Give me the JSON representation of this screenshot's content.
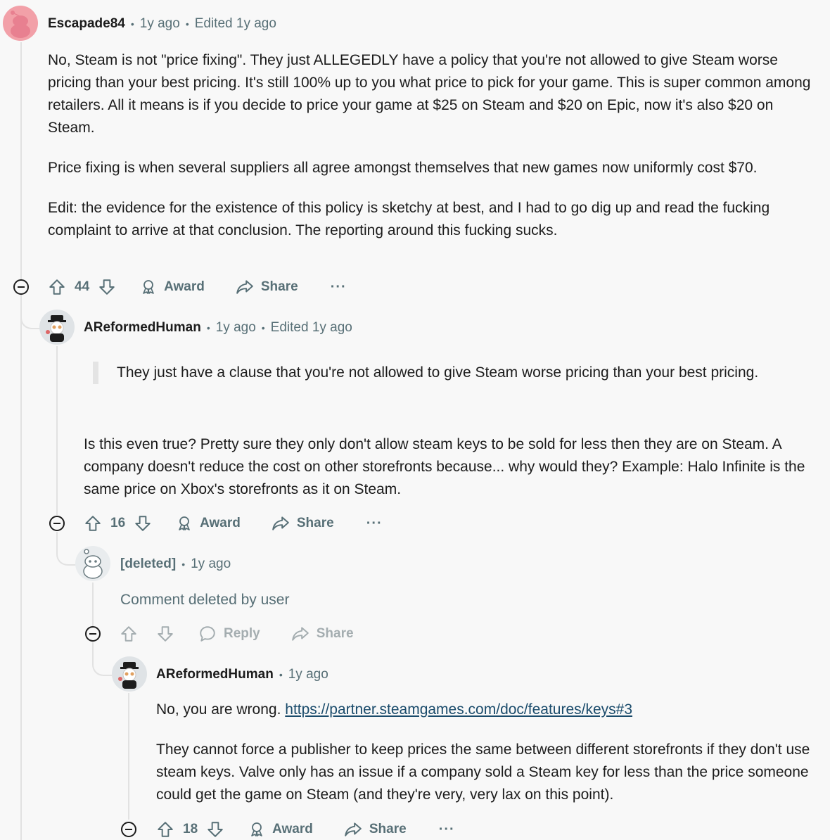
{
  "comments": [
    {
      "author": "Escapade84",
      "time": "1y ago",
      "edited": "Edited 1y ago",
      "paragraphs": [
        "No, Steam is not \"price fixing\". They just ALLEGEDLY have a policy that you're not allowed to give Steam worse pricing than your best pricing. It's still 100% up to you what price to pick for your game. This is super common among retailers. All it means is if you decide to price your game at $25 on Steam and $20 on Epic, now it's also $20 on Steam.",
        "Price fixing is when several suppliers all agree amongst themselves that new games now uniformly cost $70.",
        "Edit: the evidence for the existence of this policy is sketchy at best, and I had to go dig up and read the fucking complaint to arrive at that conclusion. The reporting around this fucking sucks."
      ],
      "score": "44",
      "award": "Award",
      "share": "Share",
      "more": "···"
    },
    {
      "author": "AReformedHuman",
      "time": "1y ago",
      "edited": "Edited 1y ago",
      "quote": "They just have a clause that you're not allowed to give Steam worse pricing than your best pricing.",
      "paragraphs": [
        "Is this even true? Pretty sure they only don't allow steam keys to be sold for less then they are on Steam. A company doesn't reduce the cost on other storefronts because... why would they? Example: Halo Infinite is the same price on Xbox's storefronts as it on Steam."
      ],
      "score": "16",
      "award": "Award",
      "share": "Share",
      "more": "···"
    },
    {
      "author": "[deleted]",
      "time": "1y ago",
      "body": "Comment deleted by user",
      "reply": "Reply",
      "share": "Share"
    },
    {
      "author": "AReformedHuman",
      "time": "1y ago",
      "lead": "No, you are wrong. ",
      "link": "https://partner.steamgames.com/doc/features/keys#3",
      "paragraph2": "They cannot force a publisher to keep prices the same between different storefronts if they don't use steam keys. Valve only has an issue if a company sold a Steam key for less than the price someone could get the game on Steam (and they're very, very lax on this point).",
      "score": "18",
      "award": "Award",
      "share": "Share",
      "more": "···"
    }
  ],
  "colors": {
    "background": "#f8f8f8",
    "text": "#1c1c1c",
    "muted": "#576f76",
    "link": "#1a4b6b",
    "avatar_pink": "#f2a0a8"
  }
}
